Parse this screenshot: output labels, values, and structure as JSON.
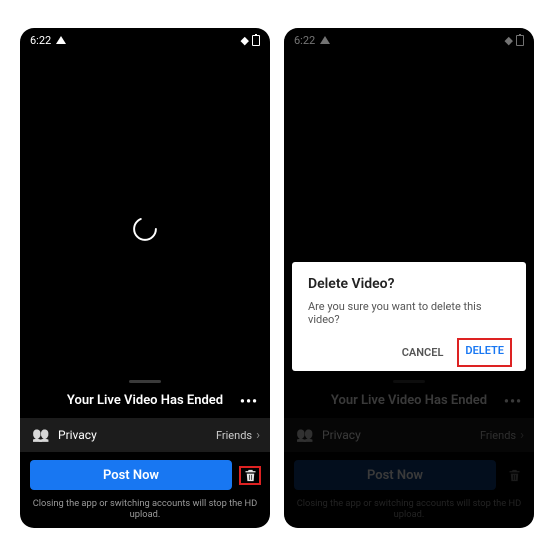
{
  "statusbar": {
    "time": "6:22"
  },
  "bottom": {
    "title": "Your Live Video Has Ended",
    "privacy_label": "Privacy",
    "privacy_value": "Friends",
    "post_button": "Post Now",
    "hint": "Closing the app or switching accounts will stop the HD upload."
  },
  "dialog": {
    "title": "Delete Video?",
    "message": "Are you sure you want to delete this video?",
    "cancel": "CANCEL",
    "delete": "DELETE"
  },
  "accent": "#1877F2",
  "highlight": "#d22"
}
